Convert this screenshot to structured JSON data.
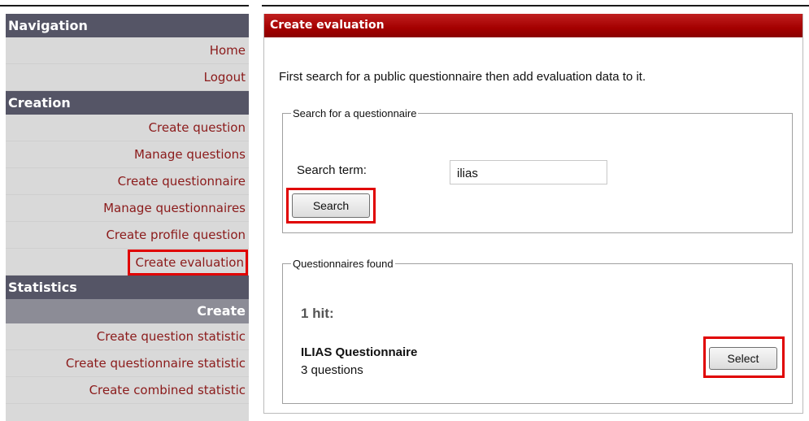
{
  "sidebar": {
    "sections": [
      {
        "title": "Navigation",
        "items": [
          "Home",
          "Logout"
        ]
      },
      {
        "title": "Creation",
        "items": [
          "Create question",
          "Manage questions",
          "Create questionnaire",
          "Manage questionnaires",
          "Create profile question",
          "Create evaluation"
        ]
      },
      {
        "title": "Statistics",
        "active": "Create",
        "items": [
          "Create question statistic",
          "Create questionnaire statistic",
          "Create combined statistic"
        ]
      }
    ]
  },
  "main": {
    "header": "Create evaluation",
    "intro": "First search for a public questionnaire then add evaluation data to it.",
    "search_box": {
      "legend": "Search for a questionnaire",
      "term_label": "Search term:",
      "term_value": "ilias",
      "button": "Search"
    },
    "found_box": {
      "legend": "Questionnaires found",
      "hits": "1 hit:",
      "result_title": "ILIAS Questionnaire",
      "result_count": "3 questions",
      "select_button": "Select"
    }
  },
  "colors": {
    "highlight": "#e00000",
    "header_red": "#a40000",
    "nav_link": "#8b1a1a",
    "section_bg": "#555566"
  }
}
